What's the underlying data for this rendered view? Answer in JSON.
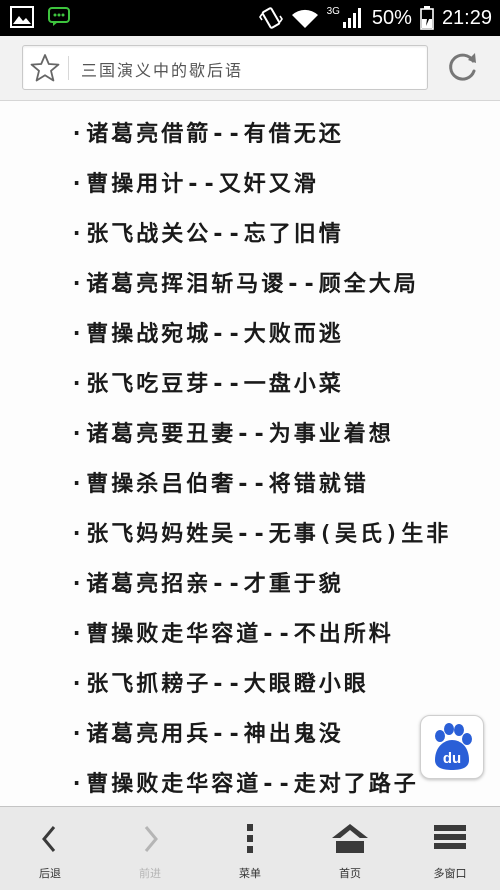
{
  "status_bar": {
    "battery": "50%",
    "time": "21:29",
    "network": "3G",
    "icons": [
      "image-notification-icon",
      "chat-notification-icon",
      "vibrate-icon",
      "wifi-icon",
      "signal-icon",
      "battery-charging-icon"
    ]
  },
  "address_bar": {
    "title": "三国演义中的歇后语",
    "bookmark_icon": "star-icon",
    "refresh_icon": "refresh-icon"
  },
  "content": {
    "items": [
      "·诸葛亮借箭--有借无还",
      "·曹操用计--又奸又滑",
      "·张飞战关公--忘了旧情",
      "·诸葛亮挥泪斩马谡--顾全大局",
      "·曹操战宛城--大败而逃",
      "·张飞吃豆芽--一盘小菜",
      "·诸葛亮要丑妻--为事业着想",
      "·曹操杀吕伯奢--将错就错",
      "·张飞妈妈姓吴--无事(吴氏)生非",
      "·诸葛亮招亲--才重于貌",
      "·曹操败走华容道--不出所料",
      "·张飞抓耪子--大眼瞪小眼",
      "·诸葛亮用兵--神出鬼没",
      "·曹操败走华容道--走对了路子"
    ],
    "floating_badge": "du"
  },
  "toolbar": {
    "back": "后退",
    "forward": "前进",
    "menu": "菜单",
    "home": "首页",
    "windows": "多窗口"
  },
  "colors": {
    "status_bar_bg": "#000000",
    "text": "#1a1a1a",
    "baidu_blue": "#2a5fd7",
    "toolbar_bg": "#e9e9e9",
    "disabled": "#b5b5b5"
  }
}
